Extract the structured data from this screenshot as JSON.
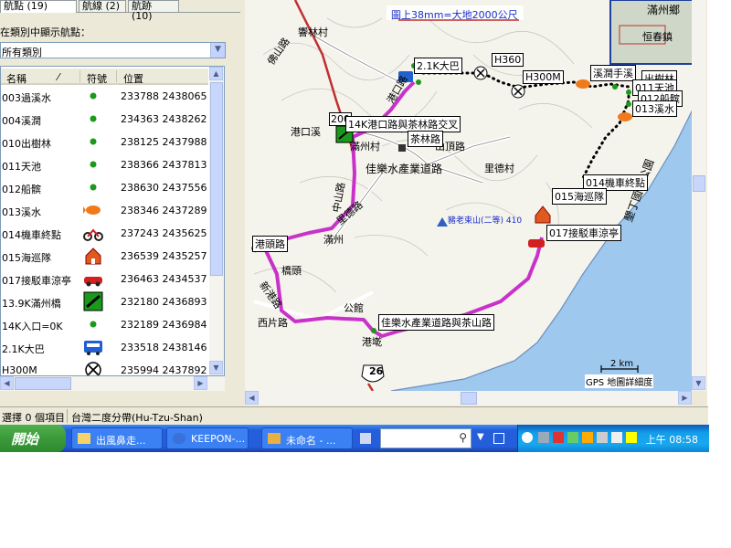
{
  "tabs": [
    "航點 (19)",
    "航線 (2)",
    "航跡 (10)"
  ],
  "filter_label": "在類別中顯示航點：",
  "filter_value": "所有類別",
  "columns": {
    "name": "名稱",
    "symbol": "符號",
    "position": "位置"
  },
  "waypoints": [
    {
      "name": "003過溪水",
      "symbol": "green-dot",
      "position": "233788 2438065"
    },
    {
      "name": "004溪澗",
      "symbol": "green-dot",
      "position": "234363 2438262"
    },
    {
      "name": "010出樹林",
      "symbol": "green-dot",
      "position": "238125 2437988"
    },
    {
      "name": "011天池",
      "symbol": "green-dot",
      "position": "238366 2437813"
    },
    {
      "name": "012船髌",
      "symbol": "green-dot",
      "position": "238630 2437556"
    },
    {
      "name": "013溪水",
      "symbol": "fish",
      "position": "238346 2437289"
    },
    {
      "name": "014機車終點",
      "symbol": "motorcycle",
      "position": "237243 2435625"
    },
    {
      "name": "015海巡隊",
      "symbol": "house",
      "position": "236539 2435257"
    },
    {
      "name": "017接駁車涼亭",
      "symbol": "car",
      "position": "236463 2434537"
    },
    {
      "name": "13.9K滿州橋",
      "symbol": "bridge",
      "position": "232180 2436893"
    },
    {
      "name": "14K入口=0K",
      "symbol": "green-dot",
      "position": "232189 2436984"
    },
    {
      "name": "2.1K大巴",
      "symbol": "bus",
      "position": "233518 2438146"
    },
    {
      "name": "H300M",
      "symbol": "x-circle",
      "position": "235994 2437892"
    }
  ],
  "map": {
    "scale_note": "圖上38mm=大地2000公尺",
    "labels": {
      "lbl_a": "響林村",
      "lbl_b": "佛山路",
      "lbl_c": "港口溪",
      "lbl_d": "滿州村",
      "lbl_e": "中山路",
      "lbl_f": "山頂路",
      "lbl_g": "里德村",
      "lbl_h": "佳樂水產業道路",
      "lbl_i": "港頭路",
      "lbl_j": "滿州",
      "lbl_k": "橋頭",
      "lbl_l": "新港路",
      "lbl_m": "西片路",
      "lbl_n": "公館",
      "lbl_o": "港墘",
      "lbl_p": "佳樂水產業道路與茶山路",
      "lbl_q": "豬老束山(二等) 410",
      "lbl_r": "里德路",
      "lbl_s": "20",
      "lbl_t": "港口路",
      "lbl_u": "恒春鎮",
      "lbl_v": "滿州鄉",
      "lbl_w": "墾丁國家公園",
      "lbl_x": "中山路",
      "lbl_y": "200",
      "lbl_z": "港口"
    },
    "waypoint_labels": {
      "w1": "2.1K大巴",
      "w2": "003過溪水",
      "w3": "H360",
      "w4": "H300M",
      "w5": "溪澗手溪",
      "w6": "出樹林",
      "w7": "011天池",
      "w8": "012船髌",
      "w9": "013溪水",
      "w10": "14K港口路與茶林路交叉",
      "w11": "茶林路",
      "w12": "014機車終點",
      "w13": "015海巡隊",
      "w14": "017接駁車涼亭",
      "w15": "14"
    },
    "route_number": "26",
    "scale_bar": "2 km",
    "detail_note": "GPS 地圖詳細度"
  },
  "status": {
    "selected": "選擇 0 個項目",
    "datum": "台灣二度分帶(Hu-Tzu-Shan)"
  },
  "taskbar": {
    "start": "開始",
    "buttons": [
      "出風鼻走...",
      "KEEPON-...",
      "未命名 - ..."
    ],
    "clock": "上午 08:58"
  },
  "colors": {
    "route": "#c832c8",
    "sea": "#9fc8ee",
    "road": "#ffffff",
    "taskbar": "#245edb"
  }
}
